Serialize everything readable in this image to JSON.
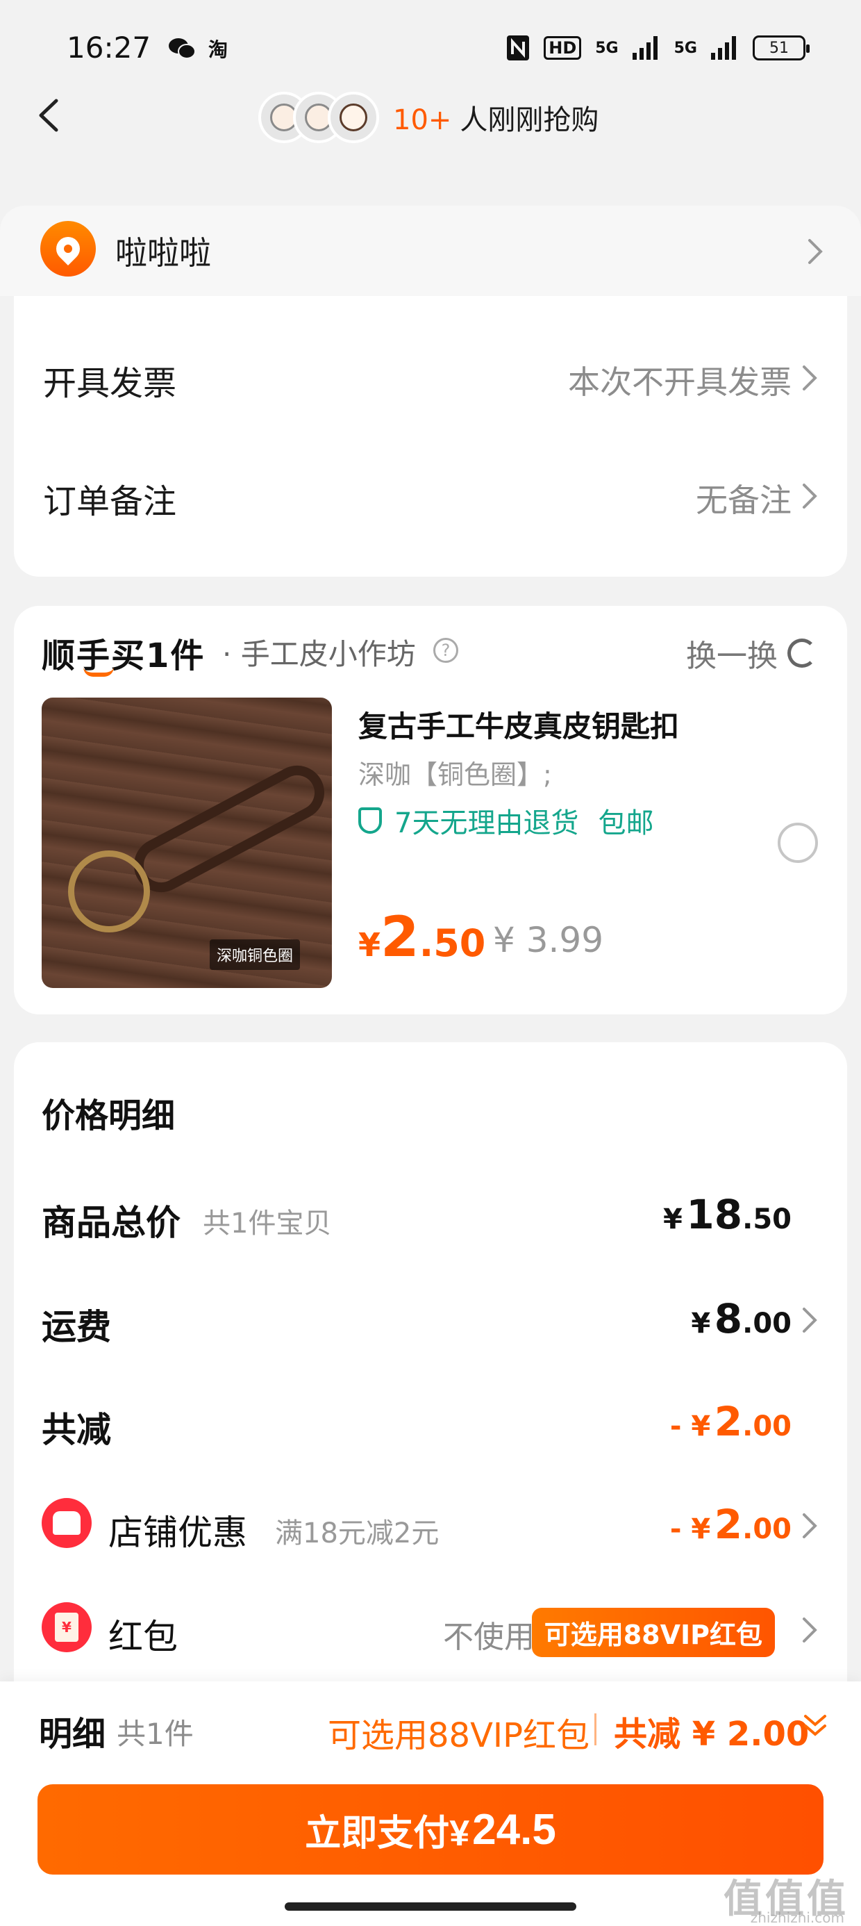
{
  "status_bar": {
    "time": "16:27",
    "left_icons": [
      "wechat-icon",
      "taobao-icon"
    ],
    "taobao_glyph": "淘",
    "battery": "51",
    "right_icons": [
      "nfc-icon",
      "hd-icon",
      "5g-signal-icon",
      "5g-signal-icon-2",
      "battery-icon"
    ],
    "hd_label": "HD",
    "signal_label": "5G"
  },
  "nav": {
    "buyers_count": "10+",
    "buyers_text": "人刚刚抢购"
  },
  "address": {
    "name": "啦啦啦"
  },
  "order_options": {
    "invoice_label": "开具发票",
    "invoice_value": "本次不开具发票",
    "note_label": "订单备注",
    "note_value": "无备注"
  },
  "addon": {
    "brand": "顺手买1件",
    "shop": "· 手工皮小作坊",
    "help": "?",
    "swap_label": "换一换",
    "item": {
      "image_tag": "深咖铜色圈",
      "title": "复古手工牛皮真皮钥匙扣",
      "spec": "深咖【铜色圈】;",
      "service_return": "7天无理由退货",
      "service_shipping": "包邮",
      "price_yen": "¥",
      "price_int": "2",
      "price_dec": ".50",
      "original_price": "¥ 3.99"
    }
  },
  "price_detail": {
    "title": "价格明细",
    "goods_label": "商品总价",
    "goods_sub": "共1件宝贝",
    "goods_yen": "¥",
    "goods_int": "18",
    "goods_dec": ".50",
    "shipping_label": "运费",
    "shipping_yen": "¥",
    "shipping_int": "8",
    "shipping_dec": ".00",
    "discount_label": "共减",
    "discount_prefix": "- ¥",
    "discount_int": "2",
    "discount_dec": ".00",
    "store_promo_label": "店铺优惠",
    "store_promo_sub": "满18元减2元",
    "store_promo_prefix": "- ¥",
    "store_promo_int": "2",
    "store_promo_dec": ".00",
    "redpacket_label": "红包",
    "redpacket_glyph": "¥",
    "redpacket_value": "不使用",
    "redpacket_badge": "可选用88VIP红包"
  },
  "bottom_bar": {
    "detail_label": "明细",
    "count": "共1件",
    "vip_text": "可选用88VIP红包",
    "save_text": "共减 ¥ 2.00",
    "pay_label": "立即支付¥",
    "pay_amount": "24.5"
  },
  "watermark": {
    "text": "值值值",
    "sub": "zhizhizhi.com"
  },
  "colors": {
    "accent": "#ff5a00",
    "green": "#15b86b",
    "teal": "#14a68c",
    "red": "#ff2d3c"
  }
}
